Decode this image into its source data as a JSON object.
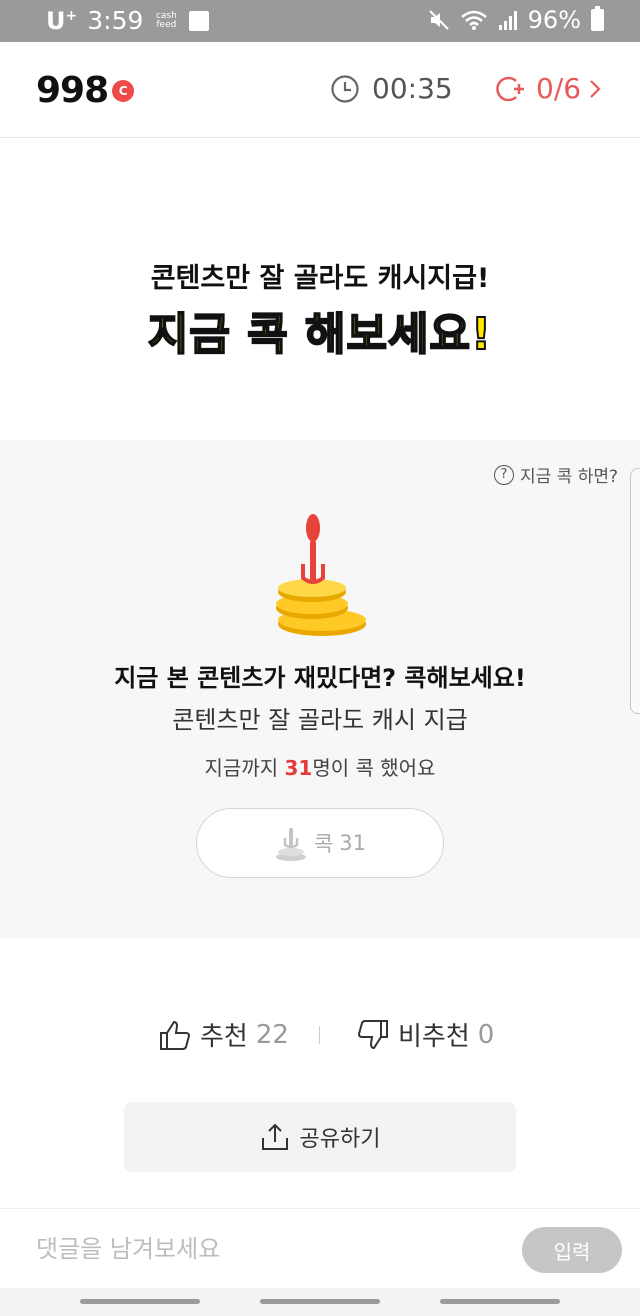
{
  "status_bar": {
    "carrier": "U",
    "carrier_sup": "+",
    "time": "3:59",
    "app_badge": "cash feed",
    "battery": "96%"
  },
  "header": {
    "points": "998",
    "points_badge": "C",
    "timer": "00:35",
    "counter": "0/6"
  },
  "promo": {
    "line1": "콘텐츠만 잘 골라도 캐시지급!",
    "line2": "지금 콕 해보세요!"
  },
  "kok": {
    "help": "지금 콕 하면?",
    "title": "지금 본 콘텐츠가 재밌다면? 콕해보세요!",
    "subtitle": "콘텐츠만 잘 골라도 캐시 지급",
    "count_prefix": "지금까지 ",
    "count": "31",
    "count_suffix": "명이 콕 했어요",
    "button_label": "콕",
    "button_count": "31"
  },
  "reactions": {
    "like_label": "추천",
    "like_count": "22",
    "dislike_label": "비추천",
    "dislike_count": "0"
  },
  "share": {
    "label": "공유하기"
  },
  "comment": {
    "placeholder": "댓글을 남겨보세요",
    "submit": "입력"
  },
  "colors": {
    "accent_red": "#e23c3c",
    "highlight_yellow": "#ffe800",
    "status_bar": "#9a9a9a"
  },
  "icons": [
    "clock-icon",
    "coin-plus-icon",
    "chevron-right-icon",
    "question-icon",
    "fork-coins-icon",
    "thumbs-up-icon",
    "thumbs-down-icon",
    "share-icon",
    "wifi-icon",
    "signal-icon",
    "mute-icon",
    "battery-icon"
  ]
}
